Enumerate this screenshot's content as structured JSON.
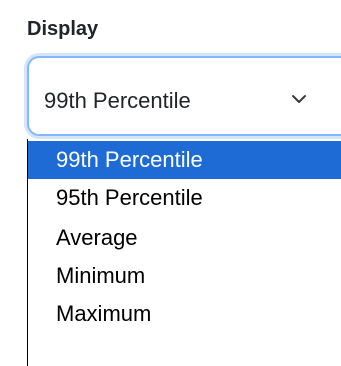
{
  "field": {
    "label": "Display"
  },
  "select": {
    "value": "99th Percentile",
    "chevron_icon": "chevron-down-icon",
    "focus_border_color": "#86b7fe"
  },
  "dropdown": {
    "selected_index": 0,
    "highlight_color": "#1f6bd6",
    "options": [
      {
        "label": "99th Percentile"
      },
      {
        "label": "95th Percentile"
      },
      {
        "label": "Average"
      },
      {
        "label": "Minimum"
      },
      {
        "label": "Maximum"
      }
    ]
  }
}
